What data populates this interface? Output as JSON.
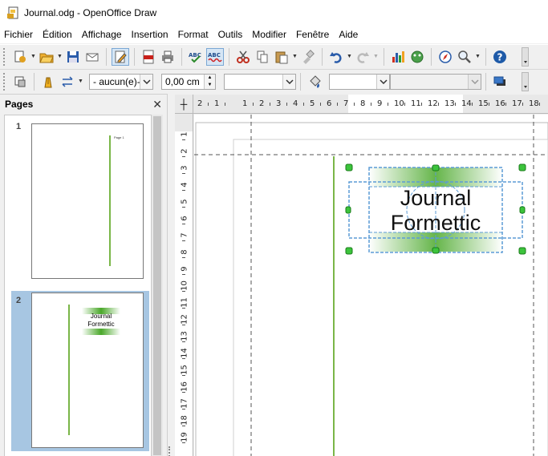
{
  "window": {
    "title": "Journal.odg - OpenOffice Draw"
  },
  "menu": [
    "Fichier",
    "Édition",
    "Affichage",
    "Insertion",
    "Format",
    "Outils",
    "Modifier",
    "Fenêtre",
    "Aide"
  ],
  "toolbar2": {
    "line_style": "- aucun(e)-",
    "line_width": "0,00 cm",
    "line_color": "",
    "area_style": "",
    "area_fill": ""
  },
  "pages_panel": {
    "title": "Pages",
    "pages": [
      {
        "number": "1",
        "thumb_text": "Page 1"
      },
      {
        "number": "2",
        "thumb_text_1": "Journal",
        "thumb_text_2": "Formettic"
      }
    ]
  },
  "hruler": {
    "labels": [
      "2",
      "1",
      "1",
      "2",
      "3",
      "4",
      "5",
      "6",
      "7",
      "8",
      "9",
      "10",
      "11",
      "12",
      "13",
      "14",
      "15",
      "16",
      "17",
      "18"
    ]
  },
  "vruler": {
    "labels": [
      "1",
      "2",
      "3",
      "4",
      "5",
      "6",
      "7",
      "8",
      "9",
      "10",
      "11",
      "12",
      "13",
      "14",
      "15",
      "16",
      "17",
      "18",
      "19"
    ]
  },
  "drawing": {
    "line1": "Journal",
    "line2": "Formettic"
  },
  "colors": {
    "green_line": "#7ab648",
    "selection": "#5b9bd5",
    "handle": "#3cc43c",
    "gradient_green": "#4aa82a"
  }
}
